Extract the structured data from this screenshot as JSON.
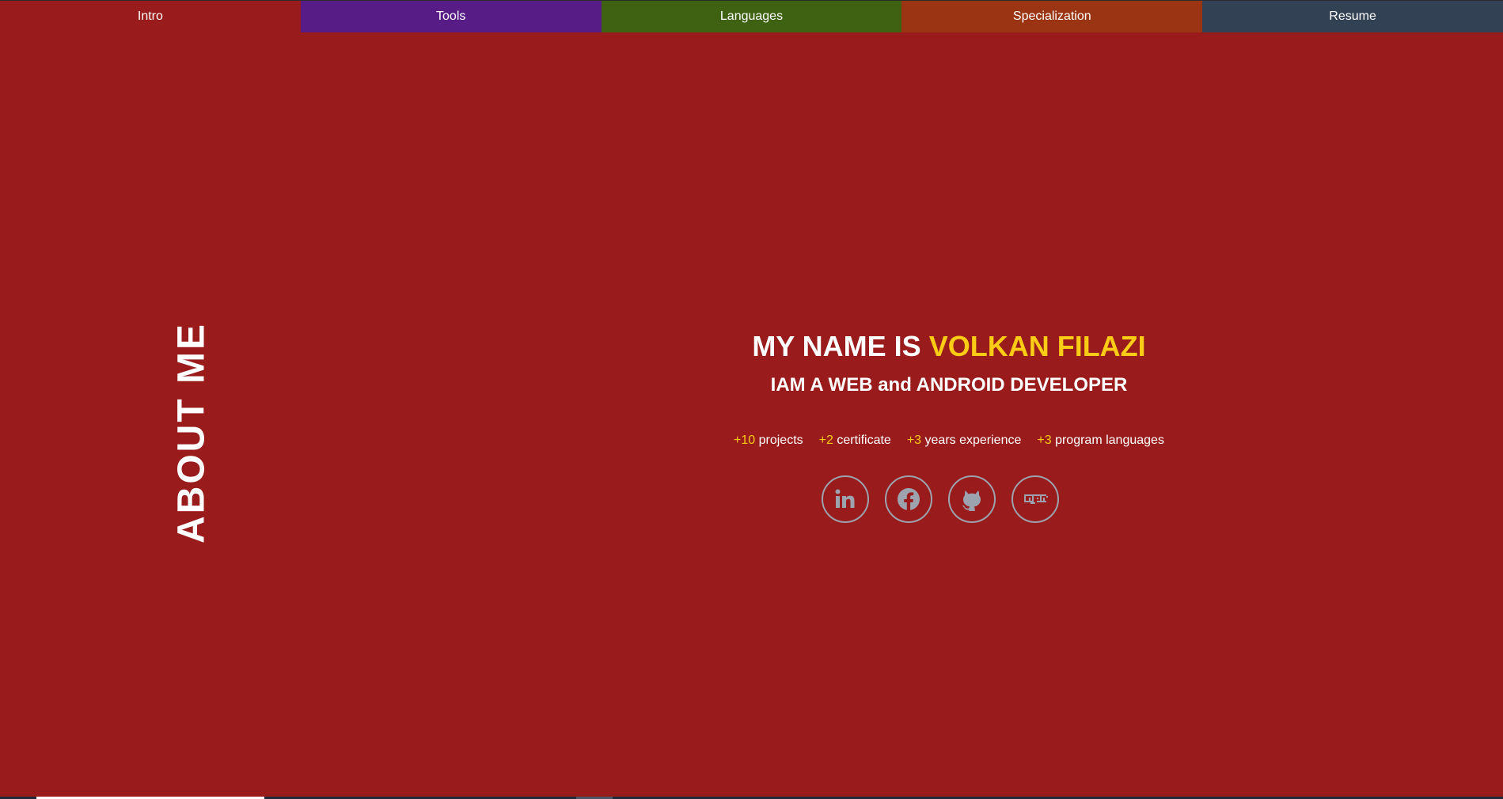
{
  "nav": {
    "items": [
      {
        "label": "Intro",
        "color": "#991b1b"
      },
      {
        "label": "Tools",
        "color": "#581c87"
      },
      {
        "label": "Languages",
        "color": "#3f6212"
      },
      {
        "label": "Specialization",
        "color": "#9a3412"
      },
      {
        "label": "Resume",
        "color": "#334155"
      }
    ],
    "active": "Intro"
  },
  "section": {
    "label": "ABOUT ME"
  },
  "hero": {
    "title_prefix": "MY NAME IS",
    "title_name": "VOLKAN FILAZI",
    "subtitle": "IAM A WEB and ANDROID DEVELOPER"
  },
  "stats": [
    {
      "value": "+10",
      "label": "projects"
    },
    {
      "value": "+2",
      "label": "certificate"
    },
    {
      "value": "+3",
      "label": "years experience"
    },
    {
      "value": "+3",
      "label": "program languages"
    }
  ],
  "socials": [
    {
      "icon": "linkedin-icon"
    },
    {
      "icon": "facebook-icon"
    },
    {
      "icon": "github-icon"
    },
    {
      "icon": "npm-icon"
    }
  ],
  "colors": {
    "background": "#991b1b",
    "accent": "#facc15",
    "icon_gray": "#9ca3af"
  }
}
